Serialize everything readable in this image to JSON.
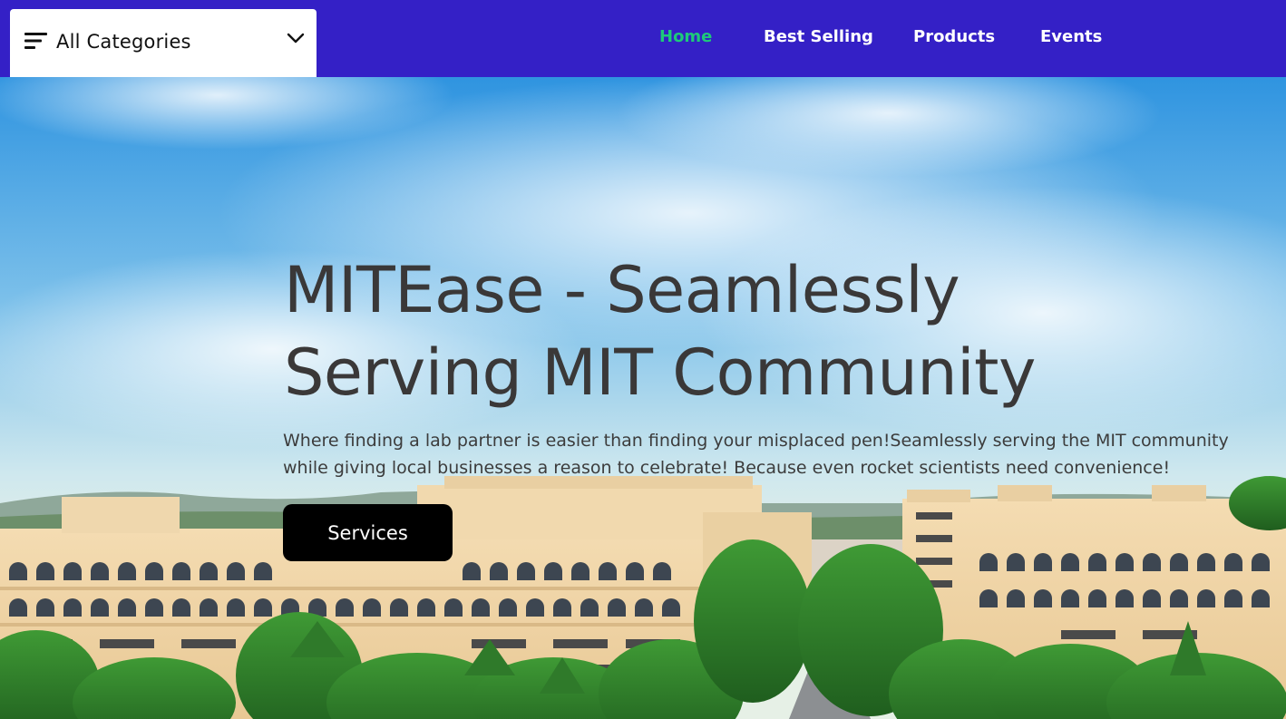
{
  "header": {
    "categories": {
      "label": "All Categories",
      "menu_icon": "menu-lines-icon",
      "dropdown_icon": "chevron-down-icon"
    },
    "nav": [
      {
        "label": "Home",
        "active": true
      },
      {
        "label": "Best Selling",
        "active": false
      },
      {
        "label": "Products",
        "active": false
      },
      {
        "label": "Events",
        "active": false
      }
    ],
    "colors": {
      "bar": "#3420c6",
      "active_link": "#1ec97a",
      "link": "#ffffff"
    }
  },
  "hero": {
    "title_line1": "MITEase - Seamlessly",
    "title_line2": "Serving MIT Community",
    "text_line1": "Where finding a lab partner is easier than finding your misplaced pen!Seamlessly serving the MIT community",
    "text_line2": "while giving local businesses a reason to celebrate! Because even rocket scientists need convenience!",
    "button_label": "Services",
    "background": "campus-photo"
  }
}
